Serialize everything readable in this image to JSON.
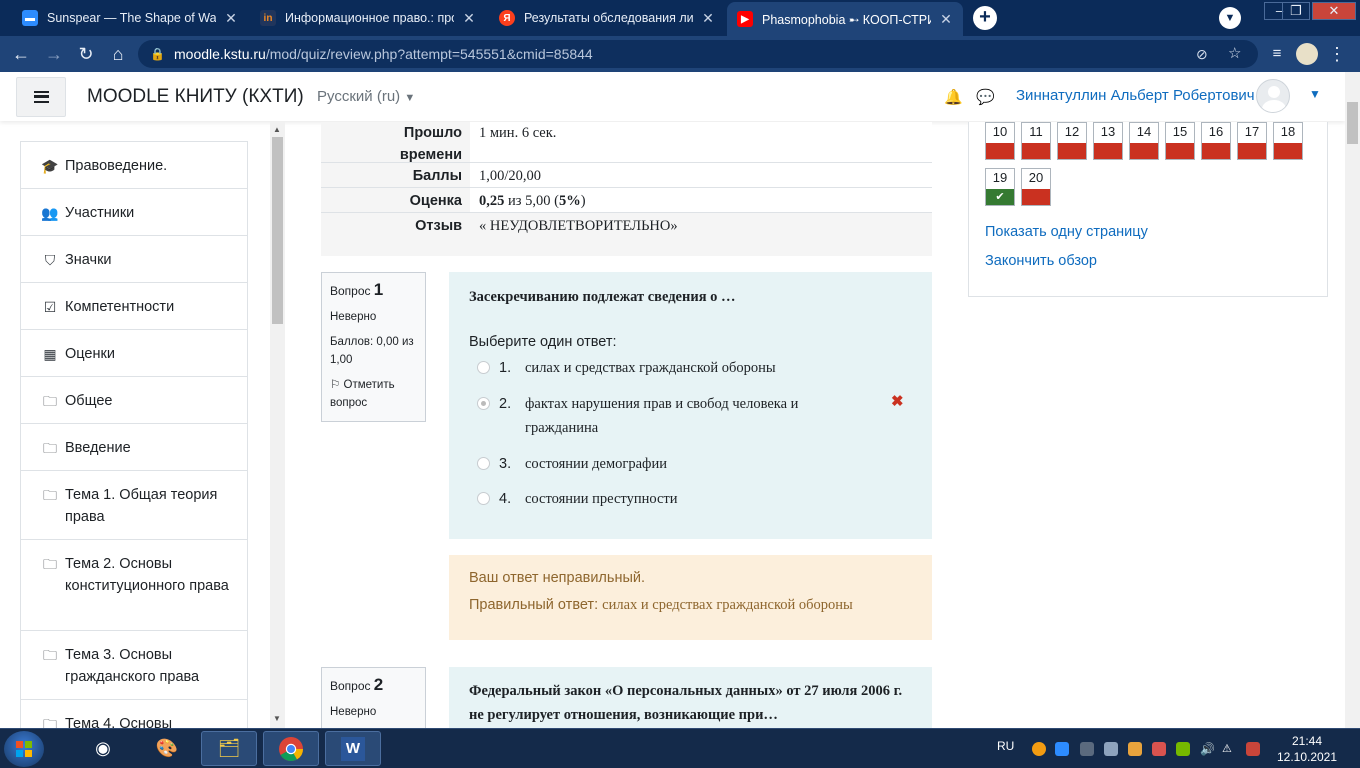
{
  "browser": {
    "tabs": [
      {
        "title": "Sunspear — The Shape of Wax",
        "close": "✕"
      },
      {
        "title": "Информационное право.: прос",
        "close": "✕"
      },
      {
        "title": "Результаты обследования лица,",
        "close": "✕"
      },
      {
        "title": "Phasmophobia ➸ КООП-СТРИМ",
        "close": "✕"
      }
    ],
    "new_tab": "+",
    "url_host": "moodle.kstu.ru",
    "url_path": "/mod/quiz/review.php?attempt=545551&cmid=85844"
  },
  "navbar": {
    "site_name": "MOODLE КНИТУ (КХТИ)",
    "language": "Русский ‎(ru)‎",
    "user_name": "Зиннатуллин Альберт Робертович"
  },
  "sidebar": {
    "items": [
      {
        "label": "Правоведение.",
        "icon": "graduation-cap-icon"
      },
      {
        "label": "Участники",
        "icon": "users-icon"
      },
      {
        "label": "Значки",
        "icon": "shield-icon"
      },
      {
        "label": "Компетентности",
        "icon": "check-square-icon"
      },
      {
        "label": "Оценки",
        "icon": "table-icon"
      },
      {
        "label": "Общее",
        "icon": "folder-icon"
      },
      {
        "label": "Введение",
        "icon": "folder-icon"
      },
      {
        "label": "Тема 1. Общая теория права",
        "icon": "folder-icon"
      },
      {
        "label": "Тема 2. Основы конституционного права",
        "icon": "folder-icon"
      },
      {
        "label": "Тема 3. Основы гражданского права",
        "icon": "folder-icon"
      },
      {
        "label": "Тема 4. Основы",
        "icon": "folder-icon"
      }
    ]
  },
  "summary": {
    "time_label": "Прошло времени",
    "time_value": "1 мин. 6 сек.",
    "points_label": "Баллы",
    "points_value": "1,00/20,00",
    "grade_label": "Оценка",
    "grade_value_bold": "0,25",
    "grade_value_mid": " из 5,00 (",
    "grade_value_pct": "5%",
    "grade_value_end": ")",
    "feedback_label": "Отзыв",
    "feedback_value": "« НЕУДОВЛЕТВОРИТЕЛЬНО»"
  },
  "questions": [
    {
      "label": "Вопрос",
      "number": "1",
      "status": "Неверно",
      "points": "Баллов: 0,00 из 1,00",
      "flag": "Отметить вопрос",
      "text": "Засекречиванию подлежат сведения о …",
      "prompt": "Выберите один ответ:",
      "options": [
        {
          "num": "1.",
          "text": "силах и средствах гражданской обороны"
        },
        {
          "num": "2.",
          "text": "фактах нарушения прав и свобод человека и гражданина"
        },
        {
          "num": "3.",
          "text": "состоянии демографии"
        },
        {
          "num": "4.",
          "text": "состоянии преступности"
        }
      ],
      "selected_option": 2,
      "feedback_wrong": "Ваш ответ неправильный.",
      "feedback_correct_label": "Правильный ответ: ",
      "feedback_correct_answer": "силах и средствах гражданской обороны"
    },
    {
      "label": "Вопрос",
      "number": "2",
      "status": "Неверно",
      "text": "Федеральный закон «О персональных данных» от 27 июля 2006 г. не регулирует отношения, возникающие при…"
    }
  ],
  "quiz_nav": {
    "buttons": [
      {
        "n": "10",
        "state": "incorrect"
      },
      {
        "n": "11",
        "state": "incorrect"
      },
      {
        "n": "12",
        "state": "incorrect"
      },
      {
        "n": "13",
        "state": "incorrect"
      },
      {
        "n": "14",
        "state": "incorrect"
      },
      {
        "n": "15",
        "state": "incorrect"
      },
      {
        "n": "16",
        "state": "incorrect"
      },
      {
        "n": "17",
        "state": "incorrect"
      },
      {
        "n": "18",
        "state": "incorrect"
      },
      {
        "n": "19",
        "state": "correct"
      },
      {
        "n": "20",
        "state": "incorrect"
      }
    ],
    "show_one_page": "Показать одну страницу",
    "finish_review": "Закончить обзор",
    "colors": {
      "incorrect": "#ca3120",
      "correct": "#357a32"
    }
  },
  "taskbar": {
    "lang": "RU",
    "time": "21:44",
    "date": "12.10.2021"
  }
}
